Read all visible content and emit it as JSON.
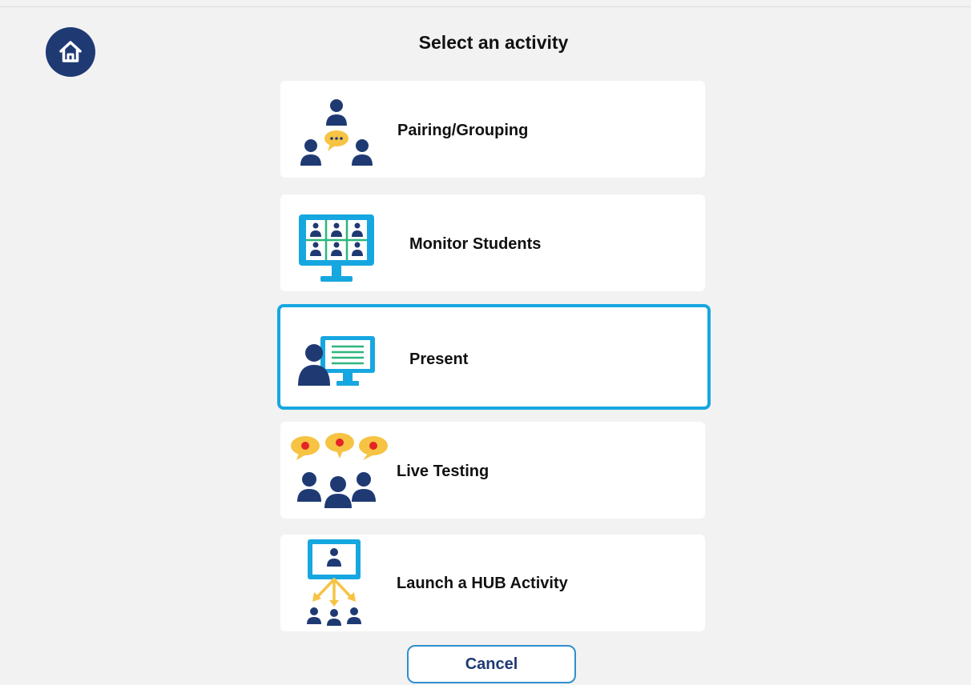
{
  "header": {
    "title": "Select an activity",
    "home_icon": "home-icon"
  },
  "activities": [
    {
      "label": "Pairing/Grouping",
      "icon": "pairing-grouping-icon"
    },
    {
      "label": "Monitor Students",
      "icon": "monitor-students-icon"
    },
    {
      "label": "Present",
      "icon": "present-icon",
      "selected": true
    },
    {
      "label": "Live Testing",
      "icon": "live-testing-icon"
    },
    {
      "label": "Launch a HUB Activity",
      "icon": "launch-hub-activity-icon"
    }
  ],
  "footer": {
    "cancel_label": "Cancel"
  },
  "colors": {
    "navy": "#1f3a73",
    "accent_blue": "#17a7e0",
    "yellow": "#f6c343",
    "red": "#e32525",
    "green": "#2cb67d",
    "background": "#f2f2f2"
  }
}
